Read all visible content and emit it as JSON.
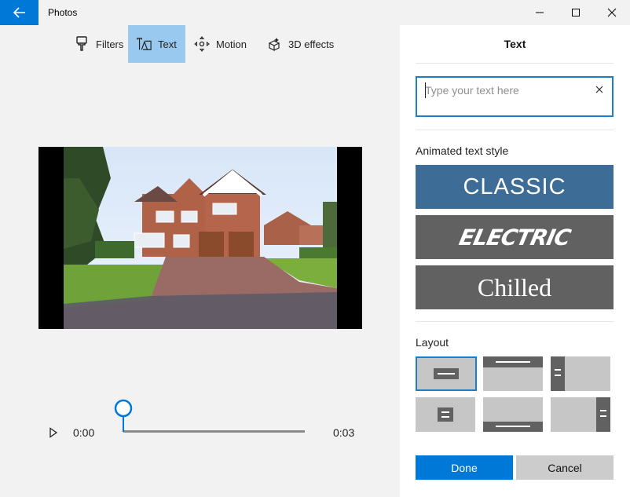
{
  "window": {
    "app_title": "Photos",
    "icons": {
      "back": "back-arrow-icon",
      "minimize": "minimize-icon",
      "maximize": "maximize-icon",
      "close": "close-icon"
    }
  },
  "toolbar": {
    "items": [
      {
        "label": "Filters",
        "icon": "paintbrush-icon"
      },
      {
        "label": "Text",
        "icon": "text-icon",
        "active": true
      },
      {
        "label": "Motion",
        "icon": "motion-icon"
      },
      {
        "label": "3D effects",
        "icon": "3d-effects-icon"
      }
    ]
  },
  "playback": {
    "current_time": "0:00",
    "end_time": "0:03",
    "play_icon": "play-icon",
    "position": 0
  },
  "panel": {
    "title": "Text",
    "text_input": {
      "value": "",
      "placeholder": "Type your text here",
      "clear_icon": "close-icon"
    },
    "animated_style_label": "Animated text style",
    "styles": [
      {
        "label": "CLASSIC",
        "color": "#3d6c96",
        "selected": true
      },
      {
        "label": "ELECTRIC",
        "color": "#616161"
      },
      {
        "label": "Chilled",
        "color": "#616161"
      }
    ],
    "layout_label": "Layout",
    "layout_options": [
      "center",
      "top",
      "left",
      "center-boxed",
      "bottom",
      "right"
    ],
    "selected_layout": "center",
    "done_label": "Done",
    "cancel_label": "Cancel"
  },
  "colors": {
    "accent": "#0078d7",
    "toolbar_active": "#99c9ee",
    "tile_gray": "#c6c6c6",
    "tile_mark": "#616161"
  }
}
